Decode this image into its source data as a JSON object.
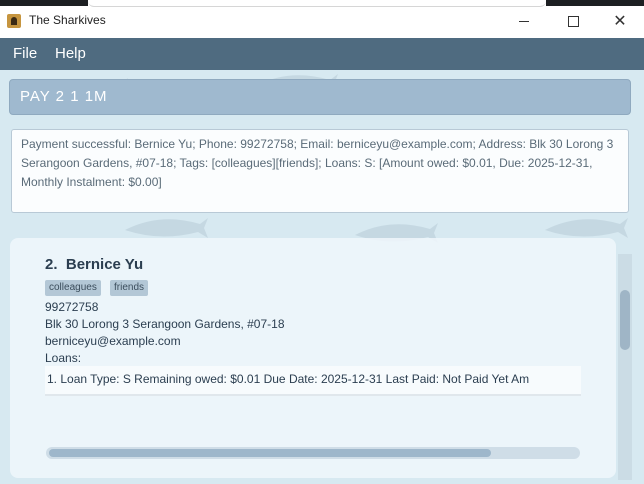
{
  "window": {
    "title": "The Sharkives"
  },
  "menu": {
    "file": "File",
    "help": "Help"
  },
  "command": {
    "value": "PAY 2 1 1M"
  },
  "result": {
    "text": "Payment successful: Bernice Yu; Phone: 99272758; Email: berniceyu@example.com; Address: Blk 30 Lorong 3 Serangoon Gardens, #07-18; Tags: [colleagues][friends]; Loans: S: [Amount owed: $0.01, Due: 2025-12-31, Monthly Instalment: $0.00]"
  },
  "person": {
    "index": "2.",
    "name": "Bernice Yu",
    "tags": [
      "colleagues",
      "friends"
    ],
    "phone": "99272758",
    "address": "Blk 30 Lorong 3 Serangoon Gardens, #07-18",
    "email": "berniceyu@example.com",
    "loans_label": "Loans:",
    "loan_line": "1. Loan Type: S   Remaining owed: $0.01   Due Date: 2025-12-31   Last Paid: Not Paid Yet   Am"
  },
  "colors": {
    "menubar": "#4f6b80",
    "command_box": "#9fb9cf",
    "background": "#d7e9f1"
  },
  "icons": {
    "app": "app-icon",
    "shark": "shark-icon"
  }
}
